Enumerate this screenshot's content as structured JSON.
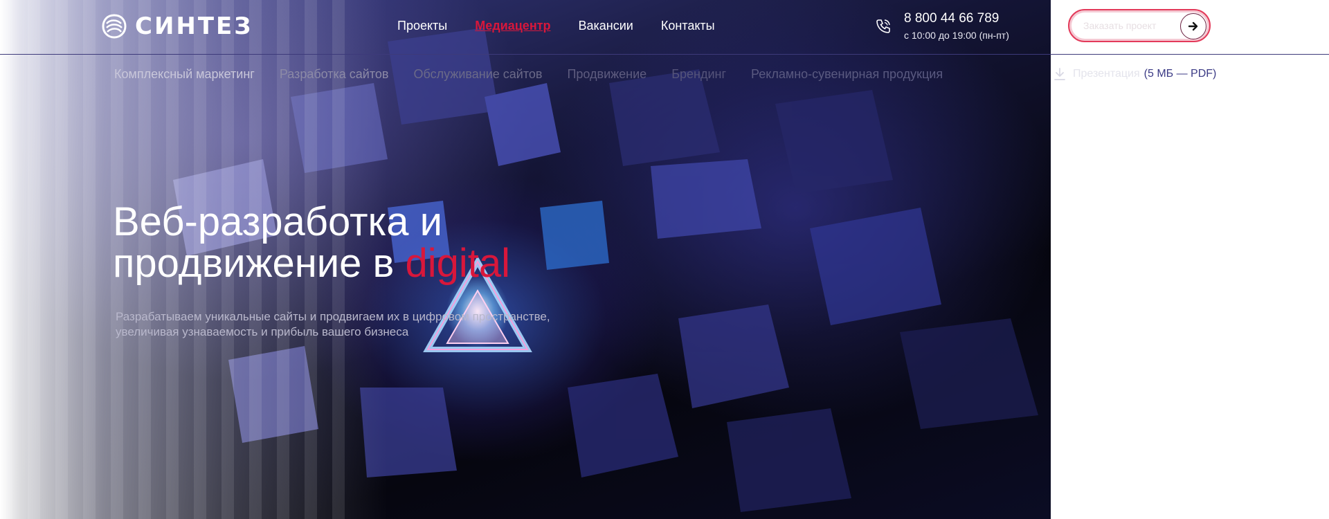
{
  "header": {
    "logo_text": "СИНТЕЗ",
    "nav": [
      {
        "label": "Проекты",
        "active": false
      },
      {
        "label": "Медиацентр",
        "active": true
      },
      {
        "label": "Вакансии",
        "active": false
      },
      {
        "label": "Контакты",
        "active": false
      }
    ],
    "phone": "8 800 44 66 789",
    "hours": "с 10:00 до 19:00 (пн-пт)",
    "order_button_label": "Заказать проект"
  },
  "services": [
    "Комплексный маркетинг",
    "Разработка сайтов",
    "Обслуживание сайтов",
    "Продвижение",
    "Брендинг",
    "Рекламно-сувенирная продукция"
  ],
  "presentation": {
    "label": "Презентация",
    "size": "(5 МБ — PDF)"
  },
  "hero": {
    "title_line1": "Веб-разработка и",
    "title_line2_start": "продвижение в ",
    "title_accent": "digital",
    "subtitle_line1": "Разрабатываем уникальные сайты и продвигаем их в цифровом пространстве,",
    "subtitle_line2": "увеличивая узнаваемость и прибыль вашего бизнеса"
  },
  "colors": {
    "accent": "#d8173b",
    "header_line": "#3d3a7a",
    "presentation_size": "#3b3a85"
  },
  "icons": [
    "logo-mark-icon",
    "phone-icon",
    "arrow-right-icon",
    "download-icon"
  ]
}
